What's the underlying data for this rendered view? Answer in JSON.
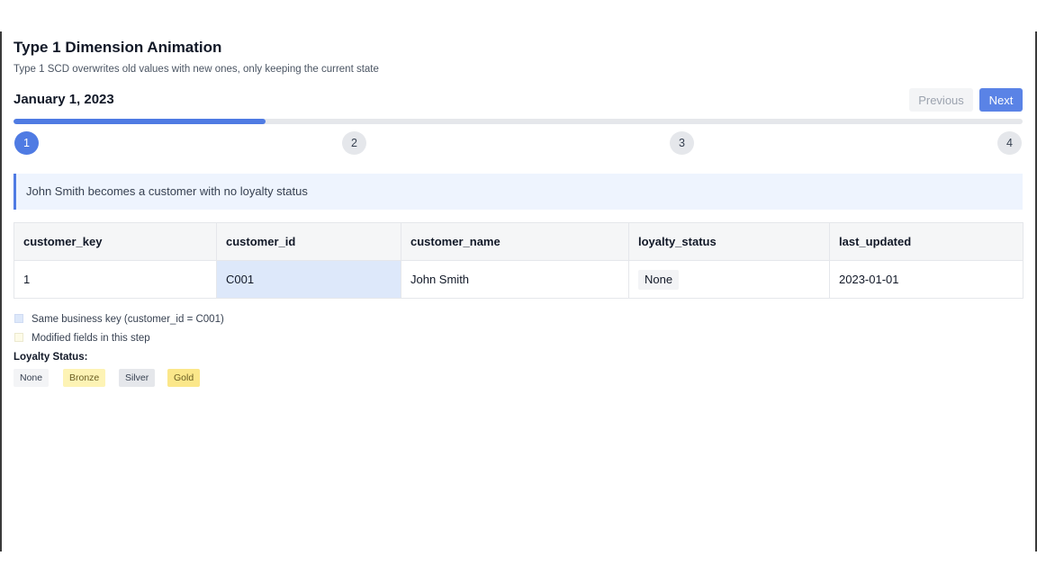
{
  "header": {
    "title": "Type 1 Dimension Animation",
    "subtitle": "Type 1 SCD overwrites old values with new ones, only keeping the current state"
  },
  "navigation": {
    "date": "January 1, 2023",
    "previous_label": "Previous",
    "next_label": "Next",
    "progress_fraction": 0.25
  },
  "steps": {
    "items": [
      "1",
      "2",
      "3",
      "4"
    ],
    "active": 1
  },
  "info": {
    "message": "John Smith becomes a customer with no loyalty status"
  },
  "table": {
    "columns": [
      "customer_key",
      "customer_id",
      "customer_name",
      "loyalty_status",
      "last_updated"
    ],
    "rows": [
      [
        "1",
        "C001",
        "John Smith",
        "None",
        "2023-01-01"
      ]
    ]
  },
  "legend": {
    "same_key": "Same business key (customer_id = C001)",
    "modified": "Modified fields in this step",
    "loyalty_label": "Loyalty Status:",
    "statuses": [
      "None",
      "Bronze",
      "Silver",
      "Gold"
    ]
  },
  "colors": {
    "accent": "#4f7be3",
    "key_highlight": "#dde8fa",
    "modified_highlight": "#fdfbe8",
    "bronze": "#fdf3b5",
    "gold": "#fbe78a"
  }
}
